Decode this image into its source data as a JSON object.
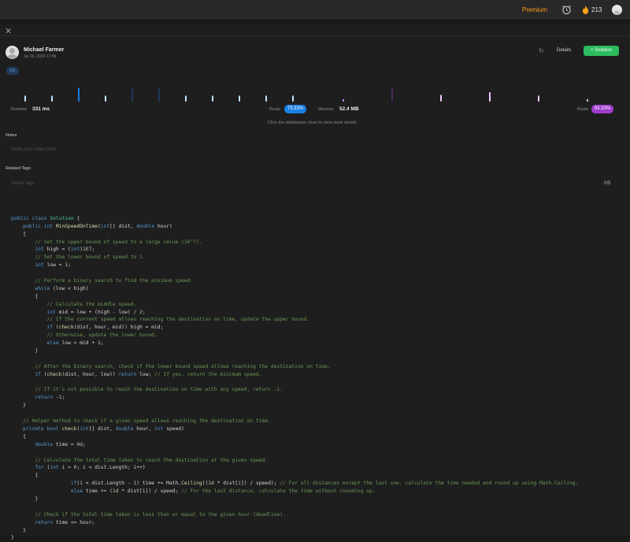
{
  "topbar": {
    "premium_label": "Premium",
    "streak_count": "213"
  },
  "submission": {
    "author": "Michael Farmer",
    "date": "Jul 26, 2023 17:39",
    "details_label": "Details",
    "solution_label": "+ Solution",
    "language": "C#"
  },
  "stats": {
    "runtime_label": "Runtime",
    "runtime_value": "331 ms",
    "runtime_beats_label": "Beats",
    "runtime_beats_value": "73.33%",
    "memory_label": "Memory",
    "memory_value": "52.4 MB",
    "memory_beats_label": "Beats",
    "memory_beats_value": "93.33%",
    "chart_hint": "Click the distribution chart to view more details"
  },
  "distribution": {
    "runtime_bars": [
      0.35,
      0.35,
      0.8,
      0.35,
      0.8,
      0.8,
      0.35,
      0.35,
      0.35,
      0.35,
      0.35
    ],
    "memory_bars": [
      0.15,
      0.8,
      0.4,
      0.55,
      0.35,
      0.15
    ]
  },
  "notes": {
    "heading": "Notes",
    "placeholder": "Write your notes here"
  },
  "tags": {
    "heading": "Related Tags",
    "placeholder": "Select tags",
    "count": "0/5"
  },
  "colors": {
    "accent_green": "#2cbb5d",
    "runtime_blue": "#1a7fe2",
    "memory_purple": "#a03bce",
    "premium_orange": "#ffa116"
  },
  "code_lines": [
    [],
    [
      [
        "kw",
        "public "
      ],
      [
        "kw",
        "class "
      ],
      [
        "ty",
        "Solution"
      ],
      [
        "pl",
        " {"
      ]
    ],
    [
      [
        "pl",
        "    "
      ],
      [
        "kw",
        "public "
      ],
      [
        "kw",
        "int "
      ],
      [
        "fn",
        "MinSpeedOnTime"
      ],
      [
        "pl",
        "("
      ],
      [
        "kw",
        "int"
      ],
      [
        "pl",
        "[] dist, "
      ],
      [
        "kw",
        "double "
      ],
      [
        "pl",
        "hour)"
      ]
    ],
    [
      [
        "pl",
        "    {"
      ]
    ],
    [
      [
        "pl",
        "        "
      ],
      [
        "cm",
        "// Set the upper bound of speed to a large value (10^7)."
      ]
    ],
    [
      [
        "pl",
        "        "
      ],
      [
        "kw",
        "int "
      ],
      [
        "pl",
        "high = ("
      ],
      [
        "kw",
        "int"
      ],
      [
        "pl",
        ")"
      ],
      [
        "nm",
        "1E7"
      ],
      [
        "pl",
        ";"
      ]
    ],
    [
      [
        "pl",
        "        "
      ],
      [
        "cm",
        "// Set the lower bound of speed to 1."
      ]
    ],
    [
      [
        "pl",
        "        "
      ],
      [
        "kw",
        "int "
      ],
      [
        "pl",
        "low = "
      ],
      [
        "nm",
        "1"
      ],
      [
        "pl",
        ";"
      ]
    ],
    [],
    [
      [
        "pl",
        "        "
      ],
      [
        "cm",
        "// Perform a binary search to find the minimum speed."
      ]
    ],
    [
      [
        "pl",
        "        "
      ],
      [
        "kw",
        "while "
      ],
      [
        "pl",
        "(low < high)"
      ]
    ],
    [
      [
        "pl",
        "        {"
      ]
    ],
    [
      [
        "pl",
        "            "
      ],
      [
        "cm",
        "// Calculate the middle speed."
      ]
    ],
    [
      [
        "pl",
        "            "
      ],
      [
        "kw",
        "int "
      ],
      [
        "pl",
        "mid = low + (high - low) / "
      ],
      [
        "nm",
        "2"
      ],
      [
        "pl",
        ";"
      ]
    ],
    [
      [
        "pl",
        "            "
      ],
      [
        "cm",
        "// If the current speed allows reaching the destination on time, update the upper bound."
      ]
    ],
    [
      [
        "pl",
        "            "
      ],
      [
        "kw",
        "if "
      ],
      [
        "pl",
        "("
      ],
      [
        "fn",
        "check"
      ],
      [
        "pl",
        "(dist, hour, mid)) high = mid;"
      ]
    ],
    [
      [
        "pl",
        "            "
      ],
      [
        "cm",
        "// Otherwise, update the lower bound."
      ]
    ],
    [
      [
        "pl",
        "            "
      ],
      [
        "kw",
        "else "
      ],
      [
        "pl",
        "low = mid + "
      ],
      [
        "nm",
        "1"
      ],
      [
        "pl",
        ";"
      ]
    ],
    [
      [
        "pl",
        "        }"
      ]
    ],
    [],
    [
      [
        "pl",
        "        "
      ],
      [
        "cm",
        "// After the binary search, check if the lower bound speed allows reaching the destination on time."
      ]
    ],
    [
      [
        "pl",
        "        "
      ],
      [
        "kw",
        "if "
      ],
      [
        "pl",
        "("
      ],
      [
        "fn",
        "check"
      ],
      [
        "pl",
        "(dist, hour, low)) "
      ],
      [
        "kw",
        "return "
      ],
      [
        "pl",
        "low; "
      ],
      [
        "cm",
        "// If yes, return the minimum speed."
      ]
    ],
    [],
    [
      [
        "pl",
        "        "
      ],
      [
        "cm",
        "// If it's not possible to reach the destination on time with any speed, return -1."
      ]
    ],
    [
      [
        "pl",
        "        "
      ],
      [
        "kw",
        "return "
      ],
      [
        "pl",
        "-"
      ],
      [
        "nm",
        "1"
      ],
      [
        "pl",
        ";"
      ]
    ],
    [
      [
        "pl",
        "    }"
      ]
    ],
    [],
    [
      [
        "pl",
        "    "
      ],
      [
        "cm",
        "// Helper method to check if a given speed allows reaching the destination on time."
      ]
    ],
    [
      [
        "pl",
        "    "
      ],
      [
        "kw",
        "private "
      ],
      [
        "kw",
        "bool "
      ],
      [
        "fn",
        "check"
      ],
      [
        "pl",
        "("
      ],
      [
        "kw",
        "int"
      ],
      [
        "pl",
        "[] dist, "
      ],
      [
        "kw",
        "double "
      ],
      [
        "pl",
        "hour, "
      ],
      [
        "kw",
        "int "
      ],
      [
        "pl",
        "speed)"
      ]
    ],
    [
      [
        "pl",
        "    {"
      ]
    ],
    [
      [
        "pl",
        "        "
      ],
      [
        "kw",
        "double "
      ],
      [
        "pl",
        "time = "
      ],
      [
        "nm",
        "0d"
      ],
      [
        "pl",
        ";"
      ]
    ],
    [],
    [
      [
        "pl",
        "        "
      ],
      [
        "cm",
        "// Calculate the total time taken to reach the destination at the given speed."
      ]
    ],
    [
      [
        "pl",
        "        "
      ],
      [
        "kw",
        "for "
      ],
      [
        "pl",
        "("
      ],
      [
        "kw",
        "int "
      ],
      [
        "pl",
        "i = "
      ],
      [
        "nm",
        "0"
      ],
      [
        "pl",
        "; i < dist.Length; i++)"
      ]
    ],
    [
      [
        "pl",
        "        {"
      ]
    ],
    [
      [
        "pl",
        "                    "
      ],
      [
        "kw",
        "if"
      ],
      [
        "pl",
        "(i < dist.Length - "
      ],
      [
        "nm",
        "1"
      ],
      [
        "pl",
        ") time += Math."
      ],
      [
        "fn",
        "Ceiling"
      ],
      [
        "pl",
        "(("
      ],
      [
        "nm",
        "1d"
      ],
      [
        "pl",
        " * dist[i]) / speed); "
      ],
      [
        "cm",
        "// For all distances except the last one, calculate the time needed and round up using Math.Ceiling."
      ]
    ],
    [
      [
        "pl",
        "                    "
      ],
      [
        "kw",
        "else "
      ],
      [
        "pl",
        "time += ("
      ],
      [
        "nm",
        "1d"
      ],
      [
        "pl",
        " * dist[i]) / speed; "
      ],
      [
        "cm",
        "// For the last distance, calculate the time without rounding up."
      ]
    ],
    [
      [
        "pl",
        "        }"
      ]
    ],
    [],
    [
      [
        "pl",
        "        "
      ],
      [
        "cm",
        "// Check if the total time taken is less than or equal to the given hour (deadline)."
      ]
    ],
    [
      [
        "pl",
        "        "
      ],
      [
        "kw",
        "return "
      ],
      [
        "pl",
        "time <= hour;"
      ]
    ],
    [
      [
        "pl",
        "    }"
      ]
    ],
    [
      [
        "pl",
        "}"
      ]
    ]
  ]
}
